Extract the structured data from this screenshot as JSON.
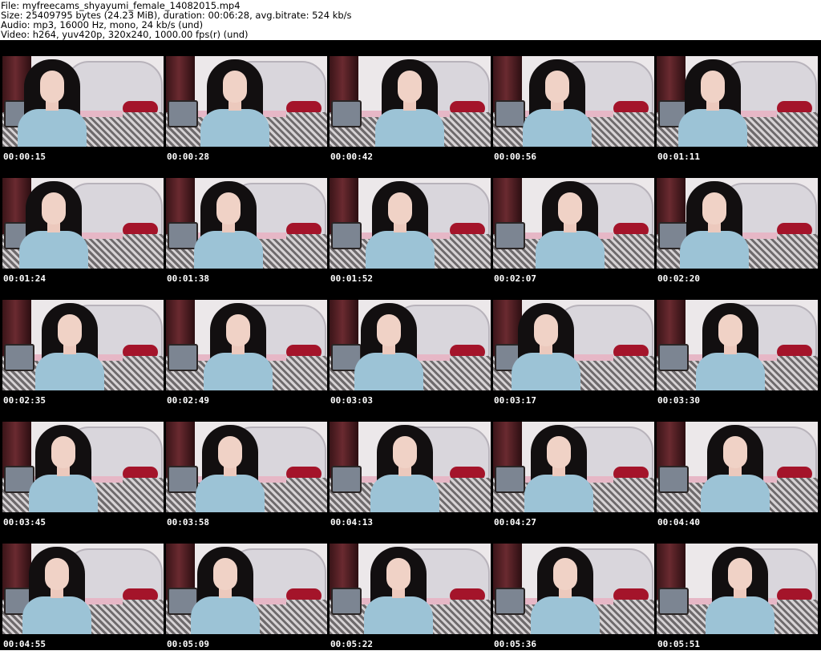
{
  "header": {
    "file": "File: myfreecams_shyayumi_female_14082015.mp4",
    "size": "Size: 25409795 bytes (24.23 MiB), duration: 00:06:28, avg.bitrate: 524 kb/s",
    "audio": "Audio: mp3, 16000 Hz, mono, 24 kb/s (und)",
    "video": "Video: h264, yuv420p, 320x240, 1000.00 fps(r) (und)"
  },
  "colors": {
    "sheet_background": "#000000",
    "timestamp_text": "#ffffff",
    "header_background": "#ffffff"
  },
  "thumbnails": [
    {
      "time": "00:00:15"
    },
    {
      "time": "00:00:28"
    },
    {
      "time": "00:00:42"
    },
    {
      "time": "00:00:56"
    },
    {
      "time": "00:01:11"
    },
    {
      "time": "00:01:24"
    },
    {
      "time": "00:01:38"
    },
    {
      "time": "00:01:52"
    },
    {
      "time": "00:02:07"
    },
    {
      "time": "00:02:20"
    },
    {
      "time": "00:02:35"
    },
    {
      "time": "00:02:49"
    },
    {
      "time": "00:03:03"
    },
    {
      "time": "00:03:17"
    },
    {
      "time": "00:03:30"
    },
    {
      "time": "00:03:45"
    },
    {
      "time": "00:03:58"
    },
    {
      "time": "00:04:13"
    },
    {
      "time": "00:04:27"
    },
    {
      "time": "00:04:40"
    },
    {
      "time": "00:04:55"
    },
    {
      "time": "00:05:09"
    },
    {
      "time": "00:05:22"
    },
    {
      "time": "00:05:36"
    },
    {
      "time": "00:05:51"
    }
  ]
}
